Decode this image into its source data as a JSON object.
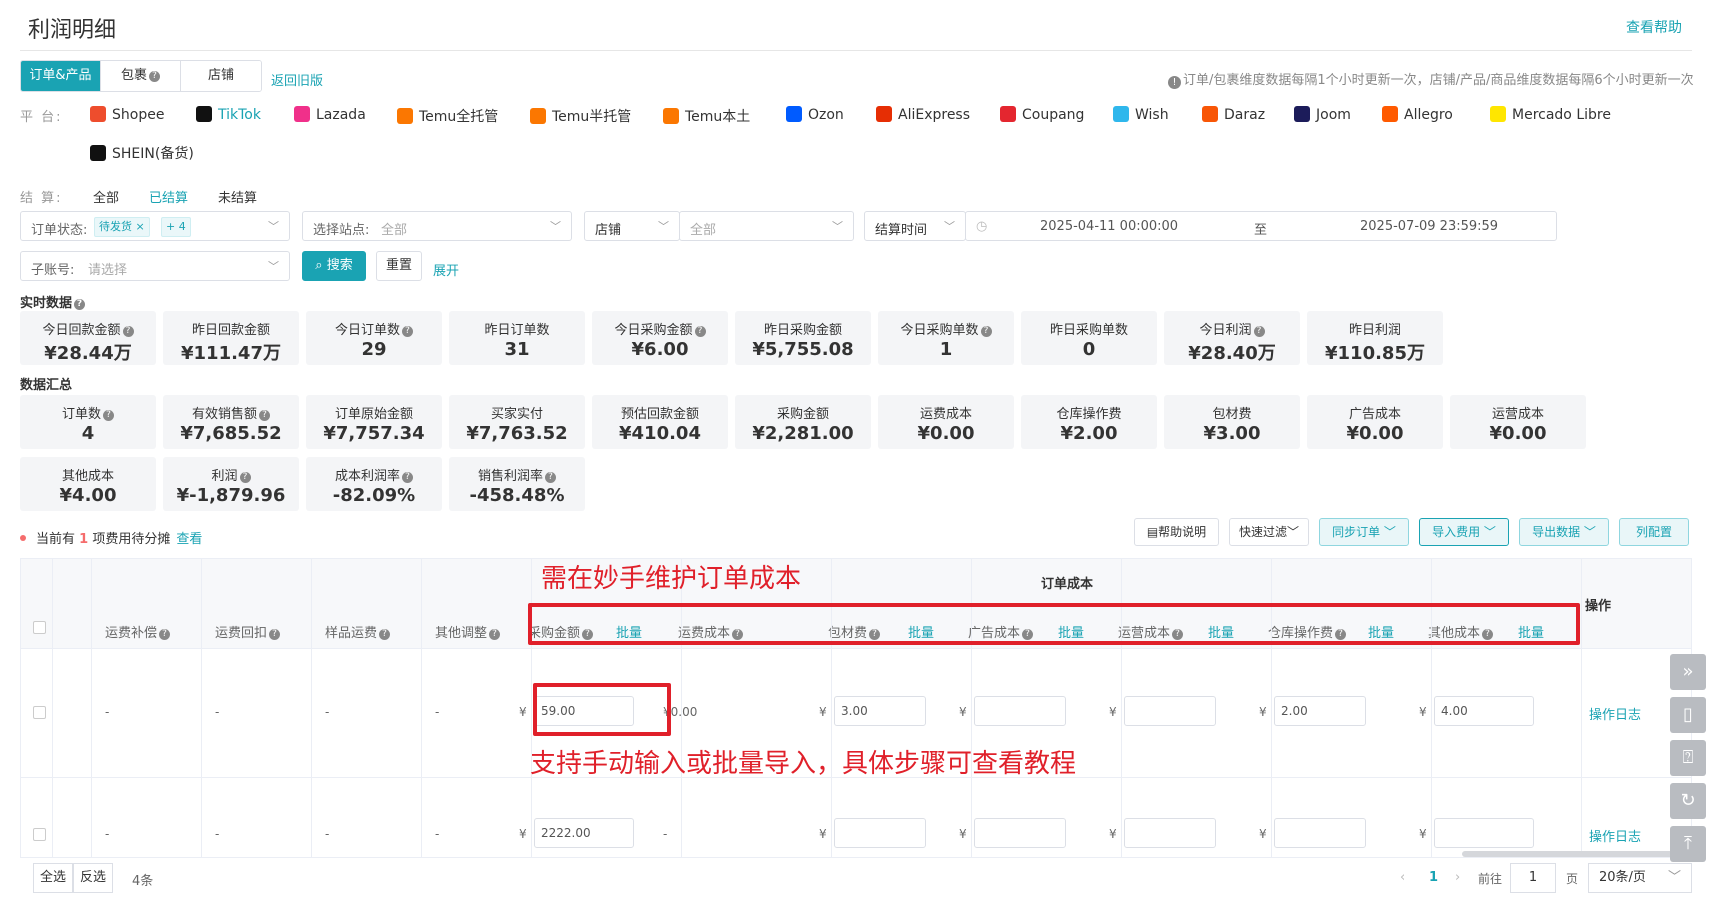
{
  "page": {
    "title": "利润明细",
    "help_link": "查看帮助"
  },
  "tabs": [
    {
      "label": "订单&产品"
    },
    {
      "label": "包裹"
    },
    {
      "label": "店铺"
    }
  ],
  "back_old": "返回旧版",
  "update_note": "订单/包裹维度数据每隔1个小时更新一次，店铺/产品/商品维度数据每隔6个小时更新一次",
  "platform_label": "平 台:",
  "platforms": [
    {
      "name": "Shopee",
      "color": "#ee4d2d"
    },
    {
      "name": "TikTok",
      "color": "#111111"
    },
    {
      "name": "Lazada",
      "color": "#f0308a"
    },
    {
      "name": "Temu全托管",
      "color": "#fb7701"
    },
    {
      "name": "Temu半托管",
      "color": "#fb7701"
    },
    {
      "name": "Temu本土",
      "color": "#fb7701"
    },
    {
      "name": "Ozon",
      "color": "#005bff"
    },
    {
      "name": "AliExpress",
      "color": "#e62e04"
    },
    {
      "name": "Coupang",
      "color": "#e4262f"
    },
    {
      "name": "Wish",
      "color": "#2fb7ec"
    },
    {
      "name": "Daraz",
      "color": "#f85606"
    },
    {
      "name": "Joom",
      "color": "#1c1c5a"
    },
    {
      "name": "Allegro",
      "color": "#ff5a00"
    },
    {
      "name": "Mercado Libre",
      "color": "#ffe600"
    },
    {
      "name": "SHEIN(备货)",
      "color": "#111111"
    }
  ],
  "settle": {
    "label": "结 算:",
    "options": [
      "全部",
      "已结算",
      "未结算"
    ]
  },
  "filters": {
    "order_status_label": "订单状态:",
    "order_status_tag": "待发货",
    "order_status_more": "+ 4",
    "site_label": "选择站点:",
    "site_value": "全部",
    "store_label": "店铺",
    "store_value": "全部",
    "time_label": "结算时间",
    "date_start": "2025-04-11 00:00:00",
    "date_to": "至",
    "date_end": "2025-07-09 23:59:59",
    "subaccount_label": "子账号:",
    "subaccount_placeholder": "请选择",
    "search_btn": "搜索",
    "reset_btn": "重置",
    "expand": "展开"
  },
  "realtime": {
    "title": "实时数据",
    "cards": [
      {
        "label": "今日回款金额",
        "value": "¥28.44万",
        "q": true
      },
      {
        "label": "昨日回款金额",
        "value": "¥111.47万",
        "q": false
      },
      {
        "label": "今日订单数",
        "value": "29",
        "q": true
      },
      {
        "label": "昨日订单数",
        "value": "31",
        "q": false
      },
      {
        "label": "今日采购金额",
        "value": "¥6.00",
        "q": true
      },
      {
        "label": "昨日采购金额",
        "value": "¥5,755.08",
        "q": false
      },
      {
        "label": "今日采购单数",
        "value": "1",
        "q": true
      },
      {
        "label": "昨日采购单数",
        "value": "0",
        "q": false
      },
      {
        "label": "今日利润",
        "value": "¥28.40万",
        "q": true
      },
      {
        "label": "昨日利润",
        "value": "¥110.85万",
        "q": false
      }
    ]
  },
  "summary": {
    "title": "数据汇总",
    "cards": [
      {
        "label": "订单数",
        "value": "4",
        "q": true
      },
      {
        "label": "有效销售额",
        "value": "¥7,685.52",
        "q": true
      },
      {
        "label": "订单原始金额",
        "value": "¥7,757.34",
        "q": false
      },
      {
        "label": "买家实付",
        "value": "¥7,763.52",
        "q": false
      },
      {
        "label": "预估回款金额",
        "value": "¥410.04",
        "q": false
      },
      {
        "label": "采购金额",
        "value": "¥2,281.00",
        "q": false
      },
      {
        "label": "运费成本",
        "value": "¥0.00",
        "q": false
      },
      {
        "label": "仓库操作费",
        "value": "¥2.00",
        "q": false
      },
      {
        "label": "包材费",
        "value": "¥3.00",
        "q": false
      },
      {
        "label": "广告成本",
        "value": "¥0.00",
        "q": false
      },
      {
        "label": "运营成本",
        "value": "¥0.00",
        "q": false
      },
      {
        "label": "其他成本",
        "value": "¥4.00",
        "q": false
      },
      {
        "label": "利润",
        "value": "¥-1,879.96",
        "q": true
      },
      {
        "label": "成本利润率",
        "value": "-82.09%",
        "q": true
      },
      {
        "label": "销售利润率",
        "value": "-458.48%",
        "q": true
      }
    ]
  },
  "pending": {
    "prefix": "当前有",
    "count": "1",
    "suffix": "项费用待分摊",
    "link": "查看"
  },
  "toolbar": {
    "help": "帮助说明",
    "quick_filter": "快速过滤",
    "sync": "同步订单",
    "import": "导入费用",
    "export": "导出数据",
    "columns": "列配置"
  },
  "table": {
    "group_header": "订单成本",
    "op_header": "操作",
    "left_cols": [
      "运费补偿",
      "运费回扣",
      "样品运费",
      "其他调整"
    ],
    "cost_cols": [
      "采购金额",
      "运费成本",
      "包材费",
      "广告成本",
      "运营成本",
      "仓库操作费",
      "其他成本"
    ],
    "batch": "批量",
    "currency": "¥",
    "dash": "-",
    "rows": [
      {
        "purchase": "59.00",
        "shipping": "¥0.00",
        "packaging": "3.00",
        "ad": "",
        "ops": "",
        "warehouse": "2.00",
        "other": "4.00",
        "op": "操作日志"
      },
      {
        "purchase": "2222.00",
        "shipping": "-",
        "packaging": "",
        "ad": "",
        "ops": "",
        "warehouse": "",
        "other": "",
        "op": "操作日志"
      }
    ]
  },
  "annotations": {
    "top": "需在妙手维护订单成本",
    "bottom": "支持手动输入或批量导入，具体步骤可查看教程"
  },
  "footer": {
    "select_all": "全选",
    "invert": "反选",
    "count": "4条",
    "current_page": "1",
    "goto": "前往",
    "page_input": "1",
    "page_unit": "页",
    "page_size": "20条/页"
  }
}
